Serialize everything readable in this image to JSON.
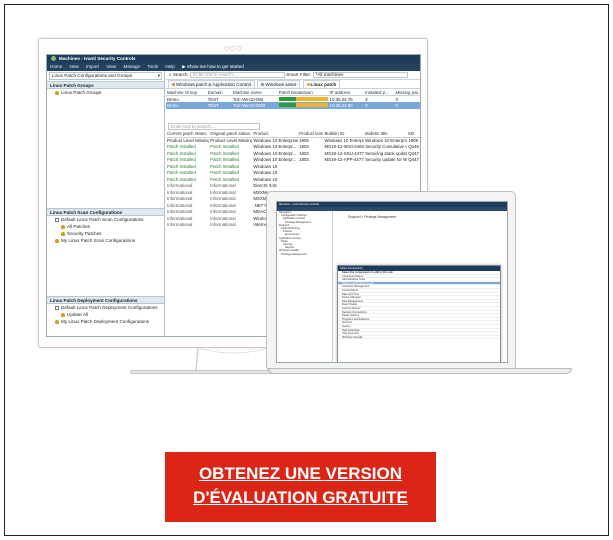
{
  "monitor": {
    "dots": "○○○",
    "window_title": "Machines - Ivanti Security Controls",
    "menu": [
      "Home",
      "New",
      "Import",
      "View",
      "Manage",
      "Tools",
      "Help"
    ],
    "show_how": "Show me how to get started",
    "left": {
      "combo": "Linux Patch Configurations and Groups",
      "groups_header": "Linux Patch Groups",
      "groups": [
        "Linux Patch Groups"
      ],
      "scan_header": "Linux Patch Scan Configurations",
      "scan_items": [
        "Default Linux Patch Scan Configurations",
        "All Patches",
        "Security Patches",
        "My Linux Patch Scan Configurations"
      ],
      "deploy_header": "Linux Patch Deployment Configurations",
      "deploy_items": [
        "Default Linux Patch Deployment Configurations",
        "Update All",
        "My Linux Patch Deployment Configurations"
      ]
    },
    "search": {
      "label": "Search:",
      "placeholder": "Enter text to search...",
      "filter_label": "Smart Filter:",
      "filter_value": "*All machines"
    },
    "tabs": [
      "Windows patch & Application Control",
      "Windows asset",
      "Linux patch"
    ],
    "machines": {
      "columns": [
        "Machine Group",
        "Domain",
        "Machine name",
        "Patch breakdown",
        "IP address",
        "Installed p...",
        "Missing pat..."
      ],
      "rows": [
        {
          "group": "Demo",
          "domain": "TEST",
          "name": "ToC-Win10-DM",
          "installed_fraction": 0.35,
          "ip": "10.35.24.75",
          "installed": "3",
          "missing": "0"
        },
        {
          "group": "Demo",
          "domain": "TEST",
          "name": "ToC-Win10-DM2",
          "installed_fraction": 0.35,
          "ip": "10.35.24.80",
          "installed": "3",
          "missing": "0"
        }
      ]
    },
    "patches": {
      "search_placeholder": "Enter text to search...",
      "columns": [
        "Current patch status",
        "Original patch status",
        "Product",
        "Product level",
        "Bulletin ID",
        "Bulletin title",
        "KB"
      ],
      "rows": [
        [
          "Product Level Missing",
          "Product Level Missing",
          "Windows 10 Enterprise...",
          "1909",
          "Windows 10 Enterprise (x...",
          "Windows 10 Enterprise (x...",
          "1909"
        ],
        [
          "Patch Installed",
          "Patch Installed",
          "Windows 10 Enterpr...",
          "1803",
          "MS19-12-W10-4483234",
          "Security Cumulative Up...",
          "Q446"
        ],
        [
          "Patch Installed",
          "Patch Installed",
          "Windows 10 Enterpr...",
          "1803",
          "MS19-12-SSU-4477137",
          "Servicing stack update f...",
          "Q447"
        ],
        [
          "Patch Installed",
          "Patch Installed",
          "Windows 10 Enterpr...",
          "1803",
          "MS19-12-APP-4477137",
          "Security update for Wind...",
          "Q447"
        ],
        [
          "Patch Installed",
          "Patch Installed",
          "Windows 10",
          "",
          "",
          "",
          ""
        ],
        [
          "Patch Installed",
          "Patch Installed",
          "Windows 10",
          "",
          "",
          "",
          ""
        ],
        [
          "Patch Installed",
          "Patch Installed",
          "Windows 10",
          "",
          "",
          "",
          ""
        ],
        [
          "Informational",
          "Informational",
          "DirectX 9.0c",
          "",
          "",
          "",
          ""
        ],
        [
          "Informational",
          "Informational",
          "MSXML 3.0",
          "",
          "",
          "",
          ""
        ],
        [
          "Informational",
          "Informational",
          "MSXML 3.0",
          "",
          "",
          "",
          ""
        ],
        [
          "Informational",
          "Informational",
          ".NET Frame",
          "",
          "",
          "",
          ""
        ],
        [
          "Informational",
          "Informational",
          "MDAC 6.2",
          "",
          "",
          "",
          ""
        ],
        [
          "Informational",
          "Informational",
          "Windows Fi",
          "",
          "",
          "",
          ""
        ],
        [
          "Informational",
          "Informational",
          "Internet Exp",
          "",
          "",
          "",
          ""
        ]
      ]
    }
  },
  "laptop": {
    "window_title": "Machines - Ivanti Security Controls",
    "header": "Endpoint > Privilege Management",
    "tree": [
      "Navigation",
      "Configuration Settings",
      "Application Control",
      "Privilege Management",
      "Endpoint",
      "Audit Monitoring",
      "Policies",
      "Environment",
      "Application Groups",
      "Rules",
      "Security",
      "Reports",
      "Windows Installer",
      "Privilege Management"
    ],
    "dialog_title": "Select Components",
    "dialog_prompt": "Select the components to add to this rule",
    "dialog_rows": [
      "Component Name",
      "Administrative Tools",
      "Backup and Restore Center",
      "Computer Management",
      "Control Panel",
      "Date and Time",
      "Device Manager",
      "Disk Management",
      "Event Viewer",
      "Internet Options",
      "Network Connections",
      "Power Options",
      "Programs and Features",
      "Services",
      "System",
      "Task Scheduler",
      "User Accounts",
      "Windows Firewall"
    ]
  },
  "cta": {
    "line1": "OBTENEZ UNE VERSION",
    "line2": "D'ÉVALUATION GRATUITE",
    "bg_color": "#db2617"
  }
}
